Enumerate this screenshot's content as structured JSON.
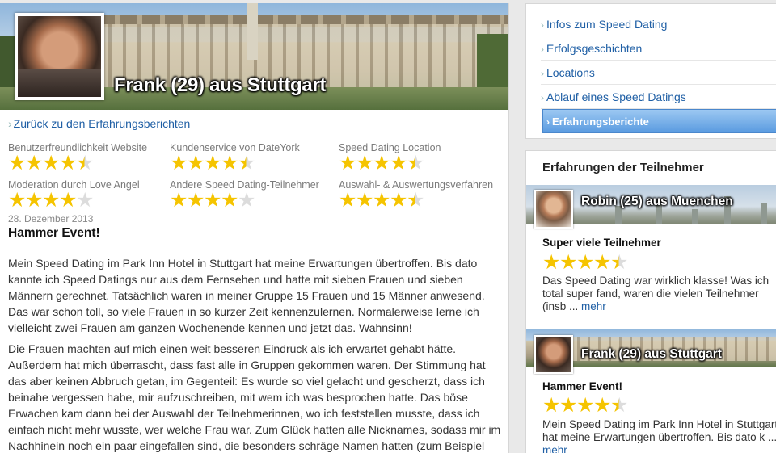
{
  "profile": {
    "title": "Frank (29) aus Stuttgart"
  },
  "back_link": "Zurück zu den Erfahrungsberichten",
  "ratings": [
    {
      "label": "Benutzerfreundlichkeit Website",
      "stars": 4.5
    },
    {
      "label": "Kundenservice von DateYork",
      "stars": 4.5
    },
    {
      "label": "Speed Dating Location",
      "stars": 4.5
    },
    {
      "label": "Moderation durch Love Angel",
      "stars": 4
    },
    {
      "label": "Andere Speed Dating-Teilnehmer",
      "stars": 4
    },
    {
      "label": "Auswahl- & Auswertungsverfahren",
      "stars": 4.5
    }
  ],
  "review": {
    "date": "28. Dezember 2013",
    "title": "Hammer Event!",
    "paragraph1": "Mein Speed Dating im Park Inn Hotel in Stuttgart hat meine Erwartungen übertroffen. Bis dato kannte ich Speed Datings nur aus dem Fernsehen und hatte mit sieben Frauen und sieben Männern gerechnet. Tatsächlich waren in meiner Gruppe 15 Frauen und 15 Männer anwesend. Das war schon toll, so viele Frauen in so kurzer Zeit kennenzulernen. Normalerweise lerne ich vielleicht zwei Frauen am ganzen Wochenende kennen und jetzt das. Wahnsinn!",
    "paragraph2": "Die Frauen machten auf mich einen weit besseren Eindruck als ich erwartet gehabt hätte. Außerdem hat mich überrascht, dass fast alle in Gruppen gekommen waren. Der Stimmung hat das aber keinen Abbruch getan, im Gegenteil: Es wurde so viel gelacht und gescherzt, dass ich beinahe vergessen habe, mir aufzuschreiben, mit wem ich was besprochen hatte. Das böse Erwachen kam dann bei der Auswahl der Teilnehmerinnen, wo ich feststellen musste, dass ich einfach nicht mehr wusste, wer welche Frau war. Zum Glück hatten alle Nicknames, sodass mir im Nachhinein noch ein paar eingefallen sind, die besonders schräge Namen hatten (zum Beispiel"
  },
  "nav": {
    "items": [
      {
        "label": "Infos zum Speed Dating"
      },
      {
        "label": "Erfolgsgeschichten"
      },
      {
        "label": "Locations"
      },
      {
        "label": "Ablauf eines Speed Datings"
      },
      {
        "label": "Erfahrungsberichte"
      }
    ],
    "active_index": 4
  },
  "experiences": {
    "heading": "Erfahrungen der Teilnehmer",
    "items": [
      {
        "name": "Robin (25) aus Muenchen",
        "title": "Super viele Teilnehmer",
        "stars": 4.5,
        "excerpt": "Das Speed Dating war wirklich klasse! Was ich total super fand, waren die vielen Teilnehmer (insb ...",
        "more": "mehr"
      },
      {
        "name": "Frank (29) aus Stuttgart",
        "title": "Hammer Event!",
        "stars": 4.5,
        "excerpt": "Mein Speed Dating im Park Inn Hotel in Stuttgart hat meine Erwartungen übertroffen. Bis dato k ...",
        "more": "mehr"
      }
    ]
  },
  "colors": {
    "link": "#1f5fa5",
    "star": "#f5c400",
    "star_empty": "#dcdcdc",
    "nav_active": "#5a9be0"
  }
}
